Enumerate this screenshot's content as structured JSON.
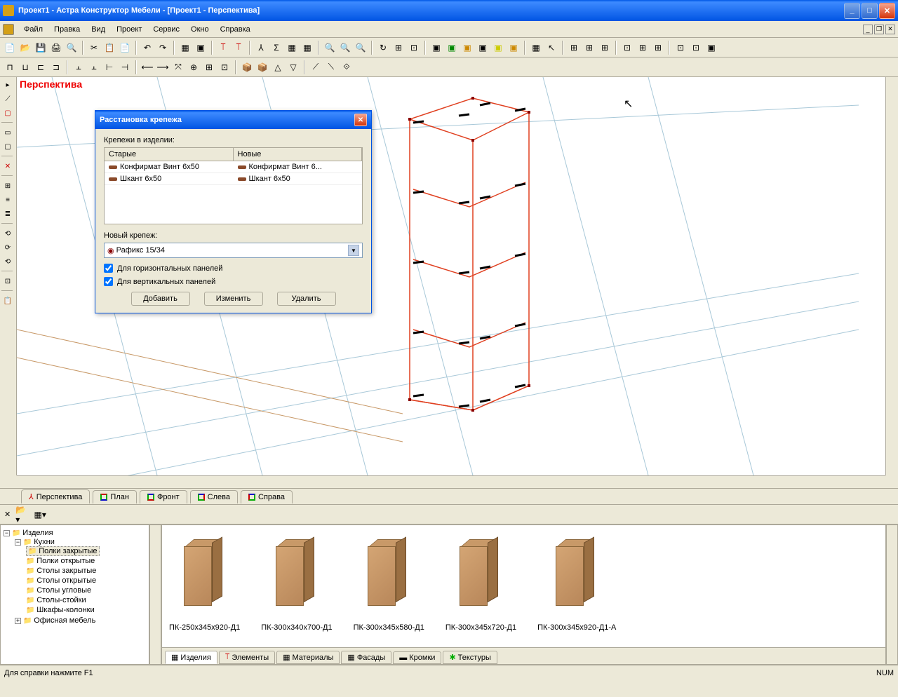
{
  "title": "Проект1 - Астра Конструктор Мебели - [Проект1 - Перспектива]",
  "menu": {
    "file": "Файл",
    "edit": "Правка",
    "view": "Вид",
    "project": "Проект",
    "service": "Сервис",
    "window": "Окно",
    "help": "Справка"
  },
  "viewport_label": "Перспектива",
  "view_tabs": {
    "perspective": "Перспектива",
    "plan": "План",
    "front": "Фронт",
    "left": "Слева",
    "right": "Справа"
  },
  "tree": {
    "root": "Изделия",
    "kitchens": "Кухни",
    "items": [
      "Полки закрытые",
      "Полки открытые",
      "Столы закрытые",
      "Столы открытые",
      "Столы угловые",
      "Столы-стойки",
      "Шкафы-колонки"
    ],
    "office": "Офисная мебель"
  },
  "gallery_items": [
    "ПК-250х345х920-Д1",
    "ПК-300х340х700-Д1",
    "ПК-300х345х580-Д1",
    "ПК-300х345х720-Д1",
    "ПК-300х345х920-Д1-А"
  ],
  "gallery_tabs": {
    "products": "Изделия",
    "elements": "Элементы",
    "materials": "Материалы",
    "facades": "Фасады",
    "edges": "Кромки",
    "textures": "Текстуры"
  },
  "status": {
    "hint": "Для справки нажмите F1",
    "num": "NUM"
  },
  "dialog": {
    "title": "Расстановка крепежа",
    "fasteners_label": "Крепежи в изделии:",
    "col_old": "Старые",
    "col_new": "Новые",
    "rows": [
      {
        "old": "Конфирмат Винт 6x50",
        "new": "Конфирмат Винт 6..."
      },
      {
        "old": "Шкант 6x50",
        "new": "Шкант 6x50"
      }
    ],
    "new_fastener_label": "Новый крепеж:",
    "combo_value": "Рафикс 15/34",
    "chk_horiz": "Для горизонтальных панелей",
    "chk_vert": "Для вертикальных панелей",
    "btn_add": "Добавить",
    "btn_edit": "Изменить",
    "btn_del": "Удалить"
  }
}
